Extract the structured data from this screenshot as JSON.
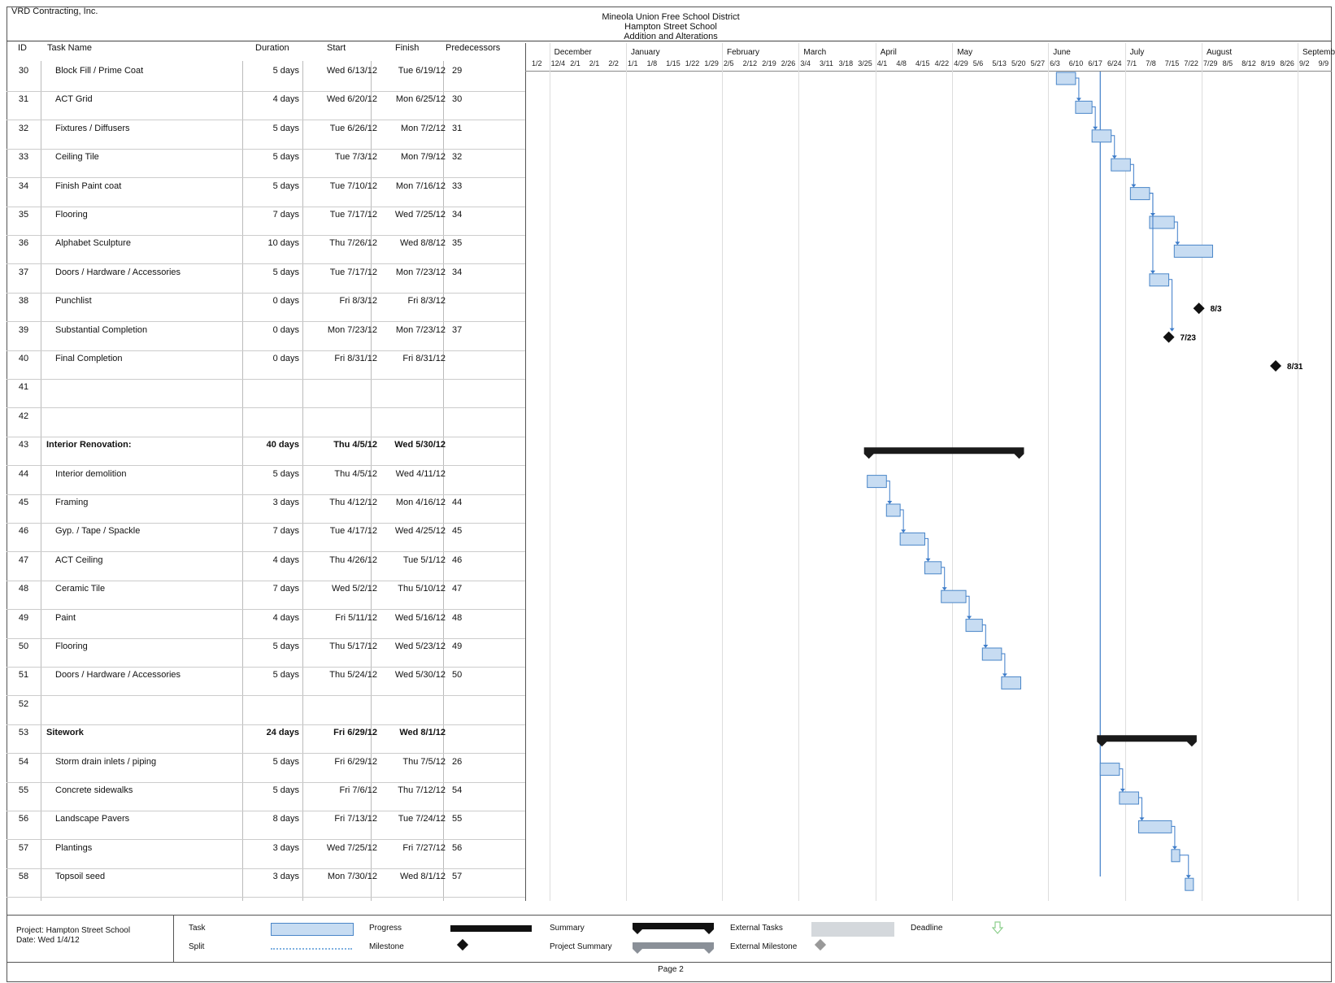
{
  "company": "VRD Contracting, Inc.",
  "title_lines": [
    "Mineola Union Free School District",
    "Hampton Street School",
    "Addition and Alterations"
  ],
  "columns": {
    "id": "ID",
    "name": "Task Name",
    "duration": "Duration",
    "start": "Start",
    "finish": "Finish",
    "pred": "Predecessors"
  },
  "months": [
    "December",
    "January",
    "February",
    "March",
    "April",
    "May",
    "June",
    "July",
    "August",
    "Septemb"
  ],
  "weeks": [
    "1/2",
    "12/4",
    "2/1",
    "2/1",
    "2/2",
    "1/1",
    "1/8",
    "1/15",
    "1/22",
    "1/29",
    "2/5",
    "2/12",
    "2/19",
    "2/26",
    "3/4",
    "3/11",
    "3/18",
    "3/25",
    "4/1",
    "4/8",
    "4/15",
    "4/22",
    "4/29",
    "5/6",
    "5/13",
    "5/20",
    "5/27",
    "6/3",
    "6/10",
    "6/17",
    "6/24",
    "7/1",
    "7/8",
    "7/15",
    "7/22",
    "7/29",
    "8/5",
    "8/12",
    "8/19",
    "8/26",
    "9/2",
    "9/9"
  ],
  "tasks": [
    {
      "id": "30",
      "name": "Block Fill / Prime Coat",
      "duration": "5 days",
      "start": "Wed 6/13/12",
      "finish": "Tue 6/19/12",
      "pred": "29",
      "type": "task"
    },
    {
      "id": "31",
      "name": "ACT Grid",
      "duration": "4 days",
      "start": "Wed 6/20/12",
      "finish": "Mon 6/25/12",
      "pred": "30",
      "type": "task"
    },
    {
      "id": "32",
      "name": "Fixtures / Diffusers",
      "duration": "5 days",
      "start": "Tue 6/26/12",
      "finish": "Mon 7/2/12",
      "pred": "31",
      "type": "task"
    },
    {
      "id": "33",
      "name": "Ceiling Tile",
      "duration": "5 days",
      "start": "Tue 7/3/12",
      "finish": "Mon 7/9/12",
      "pred": "32",
      "type": "task"
    },
    {
      "id": "34",
      "name": "Finish Paint coat",
      "duration": "5 days",
      "start": "Tue 7/10/12",
      "finish": "Mon 7/16/12",
      "pred": "33",
      "type": "task"
    },
    {
      "id": "35",
      "name": "Flooring",
      "duration": "7 days",
      "start": "Tue 7/17/12",
      "finish": "Wed 7/25/12",
      "pred": "34",
      "type": "task"
    },
    {
      "id": "36",
      "name": "Alphabet Sculpture",
      "duration": "10 days",
      "start": "Thu 7/26/12",
      "finish": "Wed 8/8/12",
      "pred": "35",
      "type": "task"
    },
    {
      "id": "37",
      "name": "Doors / Hardware / Accessories",
      "duration": "5 days",
      "start": "Tue 7/17/12",
      "finish": "Mon 7/23/12",
      "pred": "34",
      "type": "task"
    },
    {
      "id": "38",
      "name": "Punchlist",
      "duration": "0 days",
      "start": "Fri 8/3/12",
      "finish": "Fri 8/3/12",
      "pred": "",
      "type": "milestone",
      "label": "8/3"
    },
    {
      "id": "39",
      "name": "Substantial Completion",
      "duration": "0 days",
      "start": "Mon 7/23/12",
      "finish": "Mon 7/23/12",
      "pred": "37",
      "type": "milestone",
      "label": "7/23"
    },
    {
      "id": "40",
      "name": "Final Completion",
      "duration": "0 days",
      "start": "Fri 8/31/12",
      "finish": "Fri 8/31/12",
      "pred": "",
      "type": "milestone",
      "label": "8/31"
    },
    {
      "id": "41",
      "name": "",
      "duration": "",
      "start": "",
      "finish": "",
      "pred": "",
      "type": "blank"
    },
    {
      "id": "42",
      "name": "",
      "duration": "",
      "start": "",
      "finish": "",
      "pred": "",
      "type": "blank"
    },
    {
      "id": "43",
      "name": "Interior Renovation:",
      "duration": "40 days",
      "start": "Thu 4/5/12",
      "finish": "Wed 5/30/12",
      "pred": "",
      "type": "summary"
    },
    {
      "id": "44",
      "name": "Interior demolition",
      "duration": "5 days",
      "start": "Thu 4/5/12",
      "finish": "Wed 4/11/12",
      "pred": "",
      "type": "task"
    },
    {
      "id": "45",
      "name": "Framing",
      "duration": "3 days",
      "start": "Thu 4/12/12",
      "finish": "Mon 4/16/12",
      "pred": "44",
      "type": "task"
    },
    {
      "id": "46",
      "name": "Gyp. / Tape / Spackle",
      "duration": "7 days",
      "start": "Tue 4/17/12",
      "finish": "Wed 4/25/12",
      "pred": "45",
      "type": "task"
    },
    {
      "id": "47",
      "name": "ACT Ceiling",
      "duration": "4 days",
      "start": "Thu 4/26/12",
      "finish": "Tue 5/1/12",
      "pred": "46",
      "type": "task"
    },
    {
      "id": "48",
      "name": "Ceramic Tile",
      "duration": "7 days",
      "start": "Wed 5/2/12",
      "finish": "Thu 5/10/12",
      "pred": "47",
      "type": "task"
    },
    {
      "id": "49",
      "name": "Paint",
      "duration": "4 days",
      "start": "Fri 5/11/12",
      "finish": "Wed 5/16/12",
      "pred": "48",
      "type": "task"
    },
    {
      "id": "50",
      "name": "Flooring",
      "duration": "5 days",
      "start": "Thu 5/17/12",
      "finish": "Wed 5/23/12",
      "pred": "49",
      "type": "task"
    },
    {
      "id": "51",
      "name": "Doors / Hardware / Accessories",
      "duration": "5 days",
      "start": "Thu 5/24/12",
      "finish": "Wed 5/30/12",
      "pred": "50",
      "type": "task"
    },
    {
      "id": "52",
      "name": "",
      "duration": "",
      "start": "",
      "finish": "",
      "pred": "",
      "type": "blank"
    },
    {
      "id": "53",
      "name": "Sitework",
      "duration": "24 days",
      "start": "Fri 6/29/12",
      "finish": "Wed 8/1/12",
      "pred": "",
      "type": "summary"
    },
    {
      "id": "54",
      "name": "Storm drain inlets / piping",
      "duration": "5 days",
      "start": "Fri 6/29/12",
      "finish": "Thu 7/5/12",
      "pred": "26",
      "type": "task"
    },
    {
      "id": "55",
      "name": "Concrete sidewalks",
      "duration": "5 days",
      "start": "Fri 7/6/12",
      "finish": "Thu 7/12/12",
      "pred": "54",
      "type": "task"
    },
    {
      "id": "56",
      "name": "Landscape Pavers",
      "duration": "8 days",
      "start": "Fri 7/13/12",
      "finish": "Tue 7/24/12",
      "pred": "55",
      "type": "task"
    },
    {
      "id": "57",
      "name": "Plantings",
      "duration": "3 days",
      "start": "Wed 7/25/12",
      "finish": "Fri 7/27/12",
      "pred": "56",
      "type": "task"
    },
    {
      "id": "58",
      "name": "Topsoil seed",
      "duration": "3 days",
      "start": "Mon 7/30/12",
      "finish": "Wed 8/1/12",
      "pred": "57",
      "type": "task"
    }
  ],
  "legend": {
    "project": "Project: Hampton Street School",
    "date": "Date: Wed 1/4/12",
    "task": "Task",
    "split": "Split",
    "progress": "Progress",
    "milestone": "Milestone",
    "summary": "Summary",
    "project_summary": "Project Summary",
    "external_tasks": "External Tasks",
    "external_milestone": "External Milestone",
    "deadline": "Deadline"
  },
  "page": "Page 2",
  "colors": {
    "task_fill": "#c7dcf2",
    "task_border": "#4a86c8",
    "summary": "#1a1a1a",
    "milestone": "#111111",
    "link": "#3d7cc9"
  }
}
